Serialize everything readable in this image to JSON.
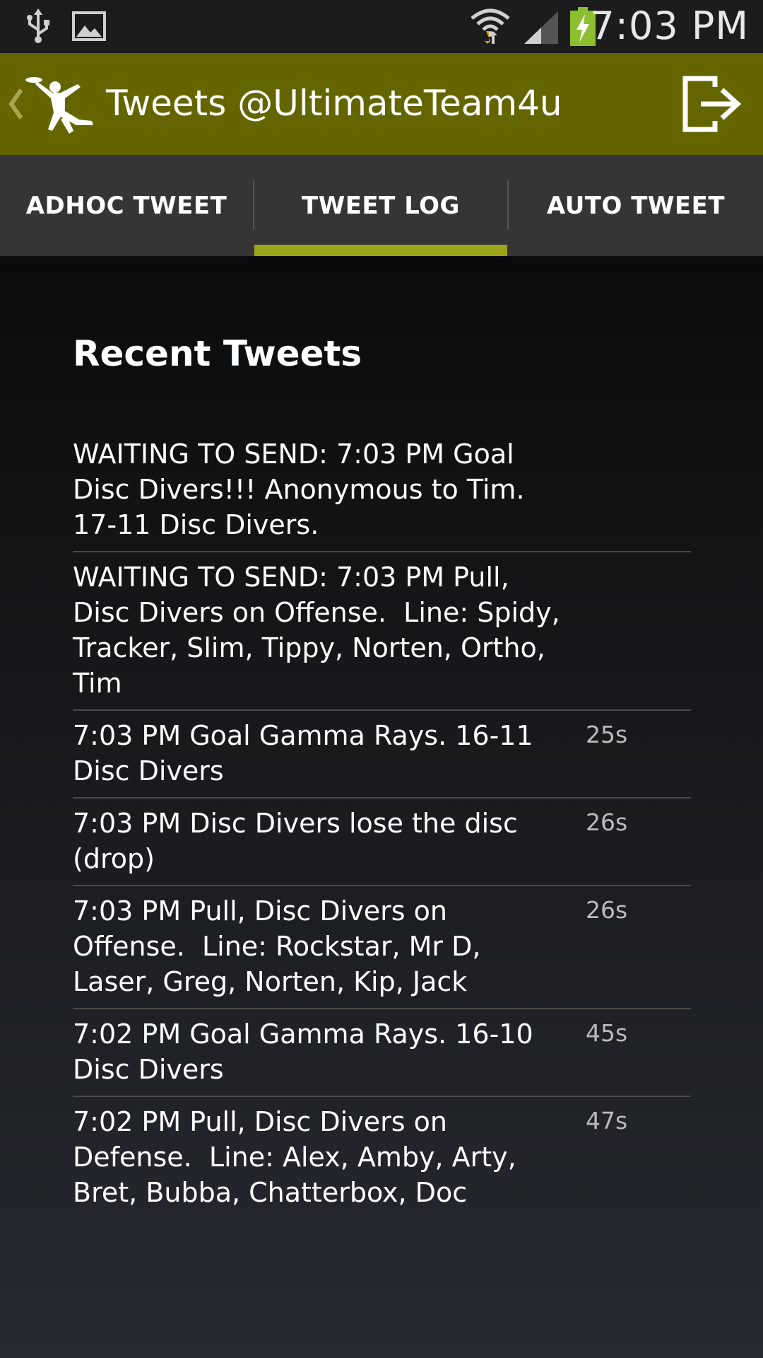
{
  "status_bar": {
    "time": "7:03 PM",
    "icons": [
      "usb-icon",
      "image-icon",
      "wifi-icon",
      "signal-icon",
      "battery-charging-icon"
    ]
  },
  "action_bar": {
    "title": "Tweets @UltimateTeam4u",
    "logo_icon": "frisbee-player-icon",
    "logout_icon": "logout-icon"
  },
  "tabs": [
    {
      "label": "ADHOC TWEET",
      "selected": false
    },
    {
      "label": "TWEET LOG",
      "selected": true
    },
    {
      "label": "AUTO TWEET",
      "selected": false
    }
  ],
  "colors": {
    "action_bar": "#656500",
    "tab_indicator": "#9ca41a",
    "tab_bar": "#353535"
  },
  "content": {
    "section_title": "Recent Tweets",
    "tweets": [
      {
        "text": "WAITING TO SEND: 7:03 PM Goal Disc Divers!!! Anonymous to Tim. 17-11 Disc Divers.",
        "age": ""
      },
      {
        "text": "WAITING TO SEND: 7:03 PM Pull, Disc Divers on Offense.  Line: Spidy, Tracker, Slim, Tippy, Norten, Ortho, Tim",
        "age": ""
      },
      {
        "text": "7:03 PM Goal Gamma Rays. 16-11 Disc Divers",
        "age": "25s"
      },
      {
        "text": "7:03 PM Disc Divers lose the disc (drop)",
        "age": "26s"
      },
      {
        "text": "7:03 PM Pull, Disc Divers on Offense.  Line: Rockstar, Mr D, Laser, Greg, Norten, Kip, Jack",
        "age": "26s"
      },
      {
        "text": "7:02 PM Goal Gamma Rays. 16-10 Disc Divers",
        "age": "45s"
      },
      {
        "text": "7:02 PM Pull, Disc Divers on Defense.  Line: Alex, Amby, Arty, Bret, Bubba, Chatterbox, Doc",
        "age": "47s"
      }
    ]
  }
}
